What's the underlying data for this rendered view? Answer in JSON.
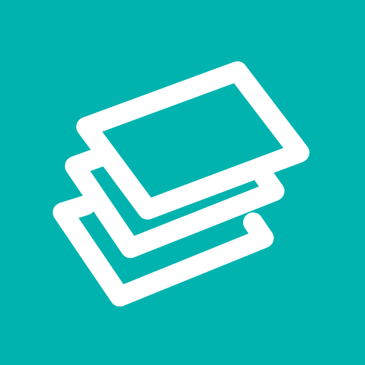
{
  "icon": {
    "name": "stacked-cards-icon",
    "background_color": "#01b3af",
    "stroke_color": "#ffffff",
    "layers": 3
  }
}
